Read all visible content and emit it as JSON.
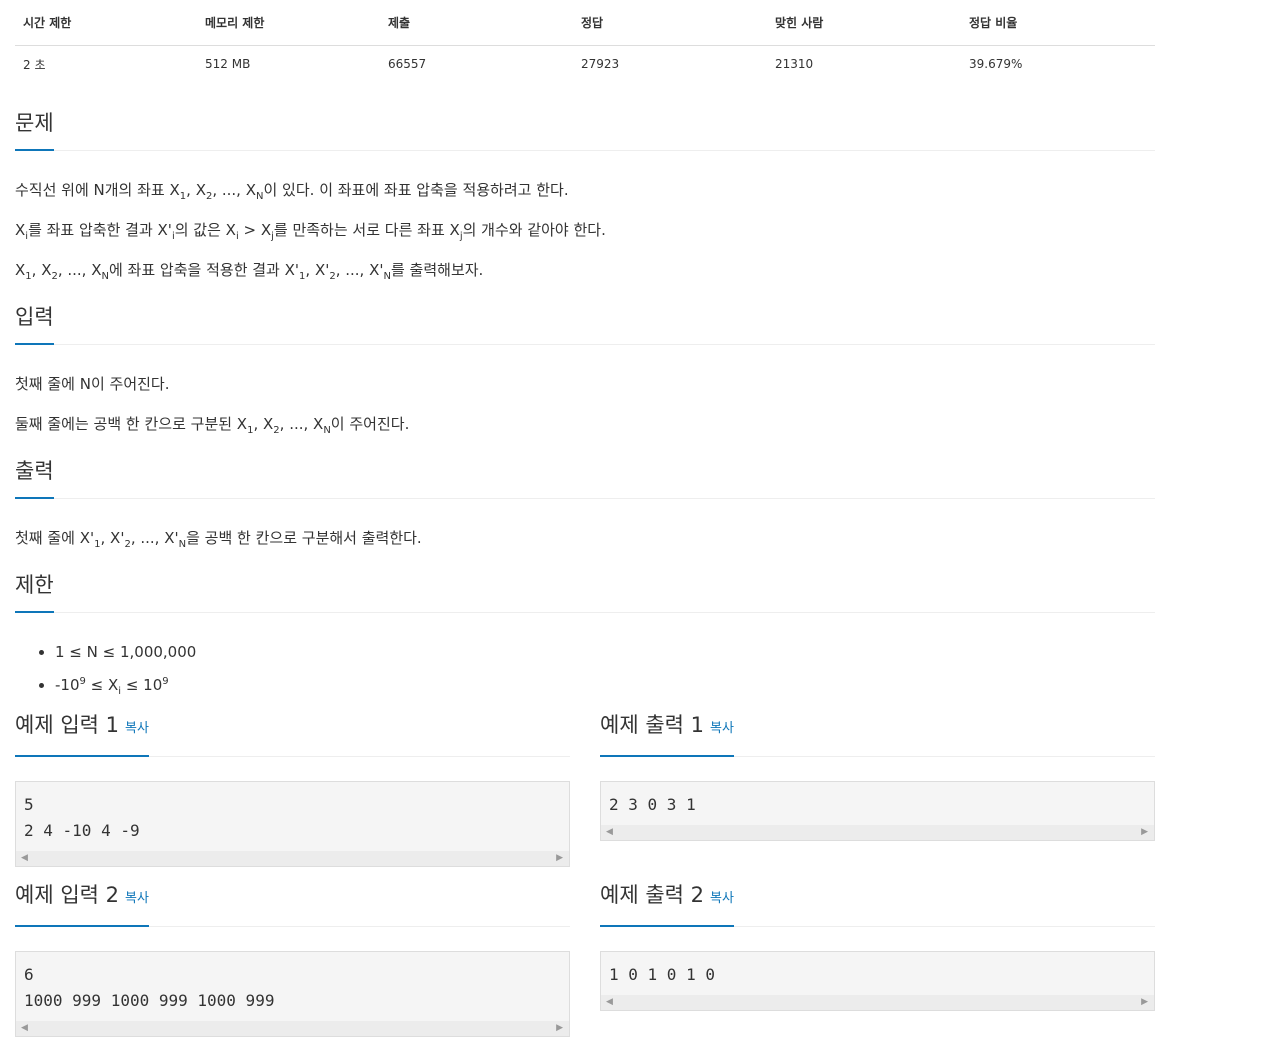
{
  "info_table": {
    "headers": [
      "시간 제한",
      "메모리 제한",
      "제출",
      "정답",
      "맞힌 사람",
      "정답 비율"
    ],
    "values": [
      "2 초",
      "512 MB",
      "66557",
      "27923",
      "21310",
      "39.679%"
    ]
  },
  "problem": {
    "title": "문제",
    "lines": [
      "수직선 위에 N개의 좌표 X1, X2, ..., XN이 있다. 이 좌표에 좌표 압축을 적용하려고 한다.",
      "Xi를 좌표 압축한 결과 X'i의 값은 Xi > Xj를 만족하는 서로 다른 좌표 Xj의 개수와 같아야 한다.",
      "X1, X2, ..., XN에 좌표 압축을 적용한 결과 X'1, X'2, ..., X'N를 출력해보자."
    ]
  },
  "input": {
    "title": "입력",
    "lines": [
      "첫째 줄에 N이 주어진다.",
      "둘째 줄에는 공백 한 칸으로 구분된 X1, X2, ..., XN이 주어진다."
    ]
  },
  "output": {
    "title": "출력",
    "lines": [
      "첫째 줄에 X'1, X'2, ..., X'N을 공백 한 칸으로 구분해서 출력한다."
    ]
  },
  "limits": {
    "title": "제한",
    "items": [
      "1 ≤ N ≤ 1,000,000",
      "-10^9 ≤ Xi ≤ 10^9"
    ]
  },
  "copy_label": "복사",
  "samples": [
    {
      "title": "예제 입력 1",
      "content": "5\n2 4 -10 4 -9"
    },
    {
      "title": "예제 출력 1",
      "content": "2 3 0 3 1"
    },
    {
      "title": "예제 입력 2",
      "content": "6\n1000 999 1000 999 1000 999"
    },
    {
      "title": "예제 출력 2",
      "content": "1 0 1 0 1 0"
    }
  ],
  "colors": {
    "accent": "#0e76b9",
    "text": "#333333",
    "sample_bg": "#f5f5f5",
    "border": "#dddddd"
  }
}
